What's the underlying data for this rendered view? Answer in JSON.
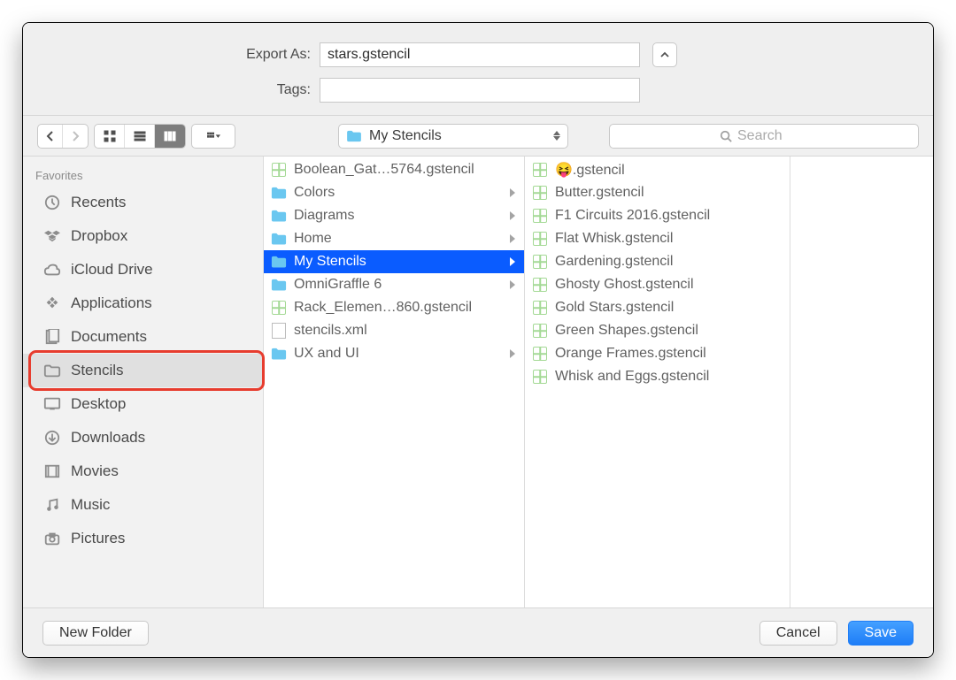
{
  "form": {
    "export_label": "Export As:",
    "export_value": "stars.gstencil",
    "tags_label": "Tags:",
    "tags_value": ""
  },
  "toolbar": {
    "path_label": "My Stencils",
    "search_placeholder": "Search"
  },
  "sidebar": {
    "header": "Favorites",
    "items": [
      {
        "label": "Recents",
        "icon": "recents"
      },
      {
        "label": "Dropbox",
        "icon": "dropbox"
      },
      {
        "label": "iCloud Drive",
        "icon": "icloud"
      },
      {
        "label": "Applications",
        "icon": "apps"
      },
      {
        "label": "Documents",
        "icon": "docs"
      },
      {
        "label": "Stencils",
        "icon": "folder",
        "highlight": true
      },
      {
        "label": "Desktop",
        "icon": "desktop"
      },
      {
        "label": "Downloads",
        "icon": "downloads"
      },
      {
        "label": "Movies",
        "icon": "movies"
      },
      {
        "label": "Music",
        "icon": "music"
      },
      {
        "label": "Pictures",
        "icon": "pictures"
      }
    ]
  },
  "column1": [
    {
      "name": "Boolean_Gat…5764.gstencil",
      "icon": "stencil"
    },
    {
      "name": "Colors",
      "icon": "folder",
      "expandable": true
    },
    {
      "name": "Diagrams",
      "icon": "folder",
      "expandable": true
    },
    {
      "name": "Home",
      "icon": "folder",
      "expandable": true
    },
    {
      "name": "My Stencils",
      "icon": "folder",
      "expandable": true,
      "selected": true
    },
    {
      "name": "OmniGraffle 6",
      "icon": "folder",
      "expandable": true
    },
    {
      "name": "Rack_Elemen…860.gstencil",
      "icon": "stencil"
    },
    {
      "name": "stencils.xml",
      "icon": "xml"
    },
    {
      "name": "UX and UI",
      "icon": "folder",
      "expandable": true
    }
  ],
  "column2": [
    {
      "name": "😝.gstencil",
      "icon": "stencil"
    },
    {
      "name": "Butter.gstencil",
      "icon": "stencil"
    },
    {
      "name": "F1 Circuits 2016.gstencil",
      "icon": "stencil"
    },
    {
      "name": "Flat Whisk.gstencil",
      "icon": "stencil"
    },
    {
      "name": "Gardening.gstencil",
      "icon": "stencil"
    },
    {
      "name": "Ghosty Ghost.gstencil",
      "icon": "stencil"
    },
    {
      "name": "Gold Stars.gstencil",
      "icon": "stencil"
    },
    {
      "name": "Green Shapes.gstencil",
      "icon": "stencil"
    },
    {
      "name": "Orange Frames.gstencil",
      "icon": "stencil"
    },
    {
      "name": "Whisk and Eggs.gstencil",
      "icon": "stencil"
    }
  ],
  "footer": {
    "new_folder": "New Folder",
    "cancel": "Cancel",
    "save": "Save"
  }
}
